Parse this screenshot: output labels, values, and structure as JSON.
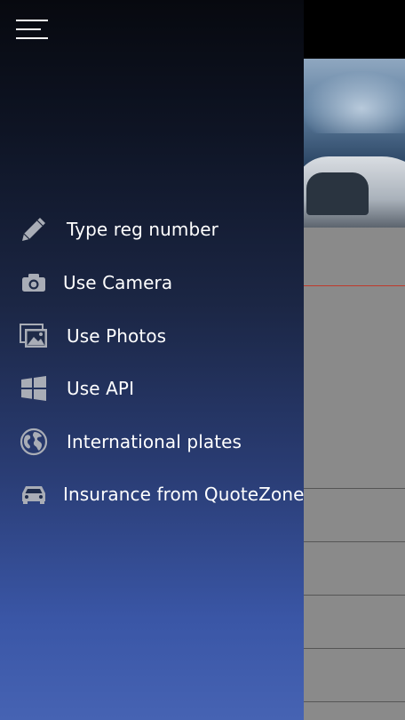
{
  "menu": {
    "items": [
      {
        "label": "Type reg number",
        "icon": "pencil-icon"
      },
      {
        "label": "Use Camera",
        "icon": "camera-icon"
      },
      {
        "label": "Use Photos",
        "icon": "photos-icon"
      },
      {
        "label": "Use API",
        "icon": "windows-logo-icon"
      },
      {
        "label": "International plates",
        "icon": "globe-icon"
      },
      {
        "label": "Insurance from QuoteZone",
        "icon": "car-icon"
      }
    ]
  },
  "colors": {
    "drawer_top": "#07090f",
    "drawer_bottom": "#4663b3",
    "icon": "#a9adb6",
    "text": "#ffffff",
    "accent_line": "#c0392b"
  }
}
